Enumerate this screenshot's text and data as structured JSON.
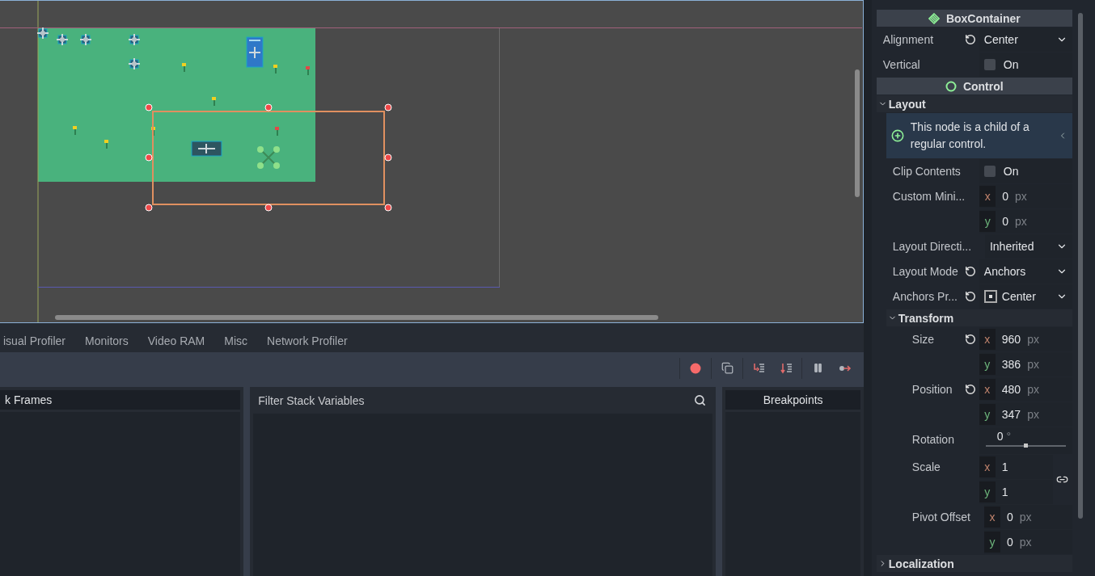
{
  "bottom_panel": {
    "tabs": [
      {
        "label": "isual Profiler",
        "selected": false
      },
      {
        "label": "Monitors",
        "selected": false
      },
      {
        "label": "Video RAM",
        "selected": false
      },
      {
        "label": "Misc",
        "selected": false
      },
      {
        "label": "Network Profiler",
        "selected": false
      }
    ],
    "stack_frames": {
      "title": "k Frames"
    },
    "stack_variables": {
      "placeholder": "Filter Stack Variables"
    },
    "breakpoints": {
      "title": "Breakpoints"
    }
  },
  "inspector": {
    "rows": [
      {
        "kind": "class-header",
        "label": "BoxContainer"
      },
      {
        "kind": "dropdown",
        "label": "Alignment",
        "value": "Center",
        "revertable": true
      },
      {
        "kind": "check",
        "label": "Vertical",
        "text": "On",
        "checked": false
      },
      {
        "kind": "class-header",
        "label": "Control"
      },
      {
        "kind": "group",
        "label": "Layout",
        "expanded": true,
        "children": [
          {
            "kind": "info",
            "text": "This node is a child of a regular control."
          },
          {
            "kind": "check",
            "label": "Clip Contents",
            "text": "On",
            "checked": false
          },
          {
            "kind": "vector",
            "label": "Custom Mini...",
            "components": [
              {
                "axis": "x",
                "value": "0",
                "unit": "px"
              },
              {
                "axis": "y",
                "value": "0",
                "unit": "px"
              }
            ]
          },
          {
            "kind": "dropdown",
            "label": "Layout Directi...",
            "value": "Inherited"
          },
          {
            "kind": "dropdown",
            "label": "Layout Mode",
            "value": "Anchors",
            "revertable": true
          },
          {
            "kind": "dropdown",
            "label": "Anchors Pr...",
            "value": "Center",
            "revertable": true,
            "preset_icon": true
          },
          {
            "kind": "group",
            "label": "Transform",
            "expanded": true,
            "children": [
              {
                "kind": "vector",
                "label": "Size",
                "revertable": true,
                "components": [
                  {
                    "axis": "x",
                    "value": "960",
                    "unit": "px"
                  },
                  {
                    "axis": "y",
                    "value": "386",
                    "unit": "px"
                  }
                ]
              },
              {
                "kind": "vector",
                "label": "Position",
                "revertable": true,
                "components": [
                  {
                    "axis": "x",
                    "value": "480",
                    "unit": "px"
                  },
                  {
                    "axis": "y",
                    "value": "347",
                    "unit": "px"
                  }
                ]
              },
              {
                "kind": "slider",
                "label": "Rotation",
                "value": "0",
                "unit": "°",
                "level": 0.5
              },
              {
                "kind": "vector",
                "label": "Scale",
                "linked": true,
                "components": [
                  {
                    "axis": "x",
                    "value": "1"
                  },
                  {
                    "axis": "y",
                    "value": "1"
                  }
                ]
              },
              {
                "kind": "vector",
                "label": "Pivot Offset",
                "components": [
                  {
                    "axis": "x",
                    "value": "0",
                    "unit": "px"
                  },
                  {
                    "axis": "y",
                    "value": "0",
                    "unit": "px"
                  }
                ]
              }
            ]
          }
        ]
      },
      {
        "kind": "group",
        "label": "Localization",
        "expanded": false
      }
    ]
  }
}
